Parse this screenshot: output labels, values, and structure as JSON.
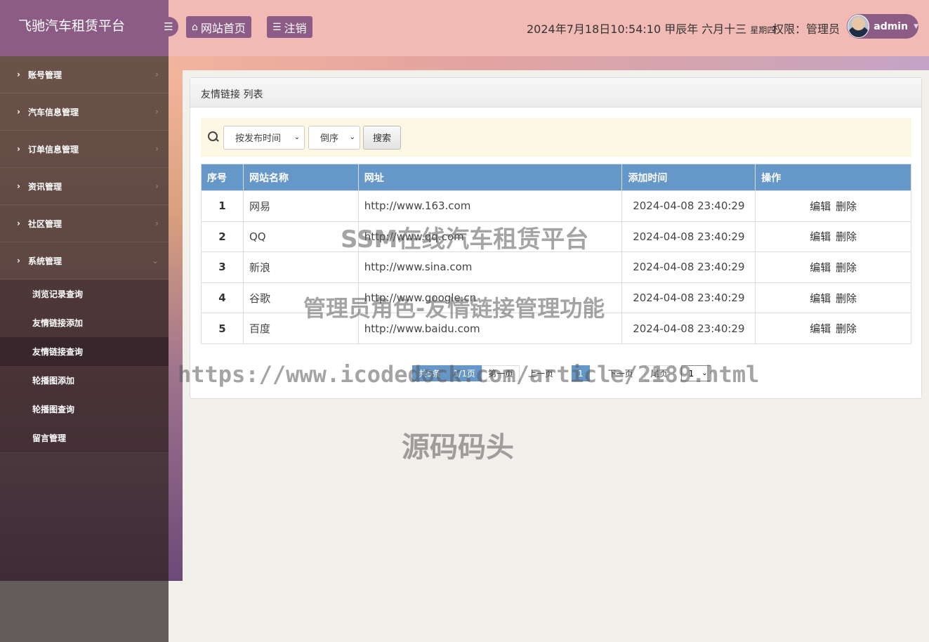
{
  "app": {
    "title": "飞驰汽车租赁平台"
  },
  "header": {
    "menu_toggle_icon": "hamburger-icon",
    "home_label": "网站首页",
    "logout_label": "注销",
    "datetime": "2024年7月18日10:54:10 甲辰年 六月十三",
    "weekday": "星期四",
    "permission": "权限：管理员",
    "username": "admin"
  },
  "sidebar": {
    "menus": [
      {
        "label": "账号管理"
      },
      {
        "label": "汽车信息管理"
      },
      {
        "label": "订单信息管理"
      },
      {
        "label": "资讯管理"
      },
      {
        "label": "社区管理"
      },
      {
        "label": "系统管理"
      }
    ],
    "submenu": [
      {
        "label": "浏览记录查询"
      },
      {
        "label": "友情链接添加"
      },
      {
        "label": "友情链接查询"
      },
      {
        "label": "轮播图添加"
      },
      {
        "label": "轮播图查询"
      },
      {
        "label": "留言管理"
      }
    ]
  },
  "panel": {
    "title": "友情链接 列表"
  },
  "search": {
    "field_select": "按发布时间",
    "order_select": "倒序",
    "button": "搜索"
  },
  "table": {
    "columns": [
      "序号",
      "网站名称",
      "网址",
      "添加时间",
      "操作"
    ],
    "rows": [
      {
        "no": "1",
        "name": "网易",
        "url": "http://www.163.com",
        "time": "2024-04-08 23:40:29"
      },
      {
        "no": "2",
        "name": "QQ",
        "url": "http://www.qq.com",
        "time": "2024-04-08 23:40:29"
      },
      {
        "no": "3",
        "name": "新浪",
        "url": "http://www.sina.com",
        "time": "2024-04-08 23:40:29"
      },
      {
        "no": "4",
        "name": "谷歌",
        "url": "http://www.google.cn",
        "time": "2024-04-08 23:40:29"
      },
      {
        "no": "5",
        "name": "百度",
        "url": "http://www.baidu.com",
        "time": "2024-04-08 23:40:29"
      }
    ],
    "edit_label": "编辑",
    "delete_label": "删除"
  },
  "pager": {
    "total": "共5条",
    "page_info": "1/1页",
    "first": "第一页",
    "prev": "上一页",
    "current": "1",
    "next": "下一页",
    "last": "尾页",
    "jump": "1"
  },
  "watermarks": {
    "line1": "SSM在线汽车租赁平台",
    "line2": "管理员角色-友情链接管理功能",
    "line3": "https://www.icodedock.com/article/2189.html",
    "line4": "源码码头"
  },
  "colors": {
    "brand": "#8d5c86",
    "topbar": "#f1bab4",
    "table_header": "#6697c9",
    "search_bg": "#fcf8e3"
  }
}
